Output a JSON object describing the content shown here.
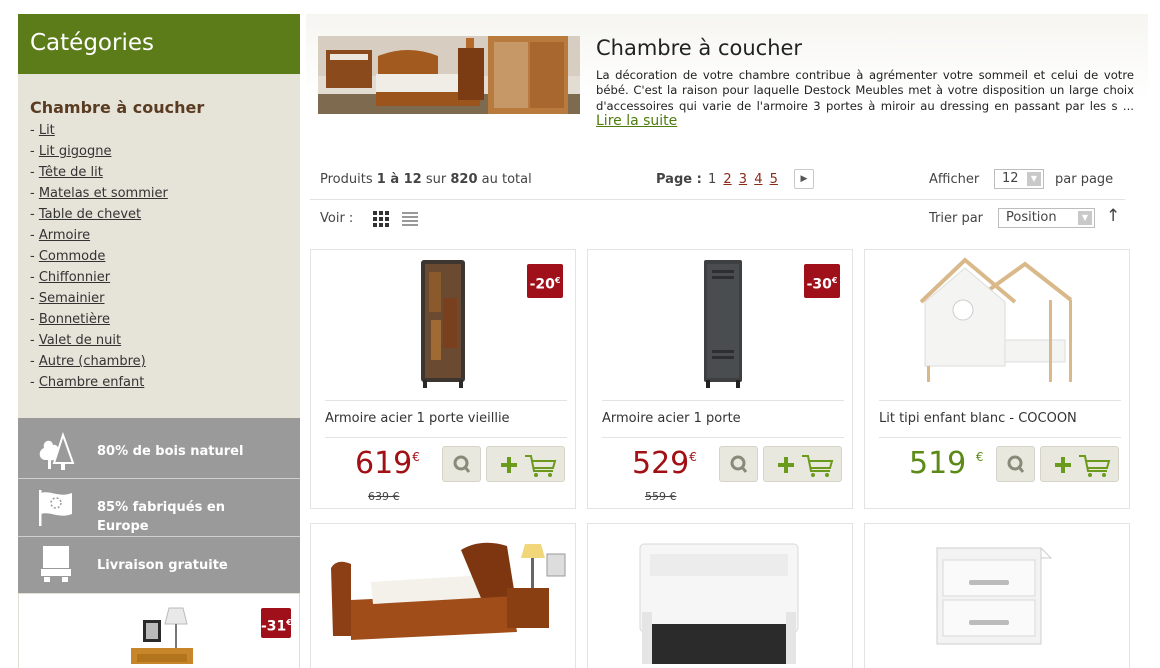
{
  "sidebar": {
    "title": "Catégories",
    "category_title": "Chambre à coucher",
    "items": [
      {
        "label": "Lit"
      },
      {
        "label": "Lit gigogne"
      },
      {
        "label": "Tête de lit"
      },
      {
        "label": "Matelas et sommier"
      },
      {
        "label": "Table de chevet"
      },
      {
        "label": "Armoire"
      },
      {
        "label": "Commode"
      },
      {
        "label": "Chiffonnier"
      },
      {
        "label": "Semainier"
      },
      {
        "label": "Bonnetière"
      },
      {
        "label": "Valet de nuit"
      },
      {
        "label": "Autre (chambre)"
      },
      {
        "label": "Chambre enfant"
      }
    ],
    "features": [
      {
        "icon": "tree-icon",
        "label": "80% de bois naturel"
      },
      {
        "icon": "europe-flag-icon",
        "label": "85% fabriqués en Europe"
      },
      {
        "icon": "delivery-truck-icon",
        "label": "Livraison gratuite"
      }
    ],
    "promo": {
      "badge_value": "-31",
      "badge_currency": "€"
    }
  },
  "banner": {
    "title": "Chambre à coucher",
    "description": "La décoration de votre chambre contribue à agrémenter votre sommeil et celui de votre bébé. C'est la raison pour laquelle Destock Meubles met à votre disposition un large choix d'accessoires qui varie de l'armoire 3 portes à miroir au dressing en passant par les s ...",
    "read_more": "Lire la suite"
  },
  "toolbar": {
    "count_prefix": "Produits",
    "count_range": "1 à 12",
    "count_sur": "sur",
    "count_total": "820",
    "count_suffix": "au total",
    "page_label": "Page :",
    "current_page": "1",
    "pages": [
      "2",
      "3",
      "4",
      "5"
    ],
    "show_label": "Afficher",
    "per_page_value": "12",
    "per_page_suffix": "par page",
    "view_label": "Voir :",
    "sort_label": "Trier par",
    "sort_value": "Position",
    "sort_direction": "↑"
  },
  "products": [
    {
      "name": "Armoire acier 1 porte vieillie",
      "price": "619",
      "currency": "€",
      "old_price": "639 €",
      "badge_value": "-20",
      "badge_currency": "€"
    },
    {
      "name": "Armoire acier 1 porte",
      "price": "529",
      "currency": "€",
      "old_price": "559 €",
      "badge_value": "-30",
      "badge_currency": "€"
    },
    {
      "name": "Lit tipi enfant blanc - COCOON",
      "price": "519",
      "currency": "€"
    }
  ],
  "colors": {
    "brand_green": "#5c7c1a",
    "sidebar_bg": "#e6e3d9",
    "promo_red": "#a0101a",
    "price_red": "#a11015",
    "price_green": "#5b8a16"
  }
}
